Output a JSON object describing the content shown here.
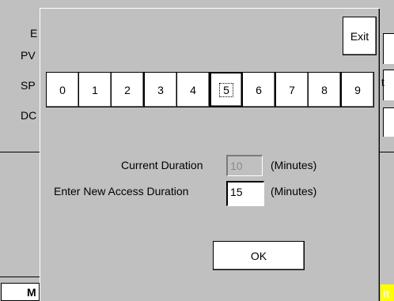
{
  "background_window": {
    "label_e": "E",
    "label_pv": "PV",
    "label_sp": "SP",
    "label_dc": "DC",
    "right_fragment": "t",
    "bottom_left_fragment": "M",
    "bottom_right_fragment": "it"
  },
  "dialog": {
    "exit_label": "Exit",
    "keypad": {
      "keys": [
        "0",
        "1",
        "2",
        "3",
        "4",
        "5",
        "6",
        "7",
        "8",
        "9"
      ],
      "selected": "5"
    },
    "current_duration": {
      "label": "Current Duration",
      "value": "10",
      "unit": "(Minutes)"
    },
    "new_duration": {
      "label": "Enter New Access Duration",
      "value": "15",
      "unit": "(Minutes)"
    },
    "ok_label": "OK"
  },
  "colors": {
    "dialog_bg": "#c0c0c0",
    "button_bg": "#ffffff",
    "highlight_yellow": "#ffff00"
  }
}
